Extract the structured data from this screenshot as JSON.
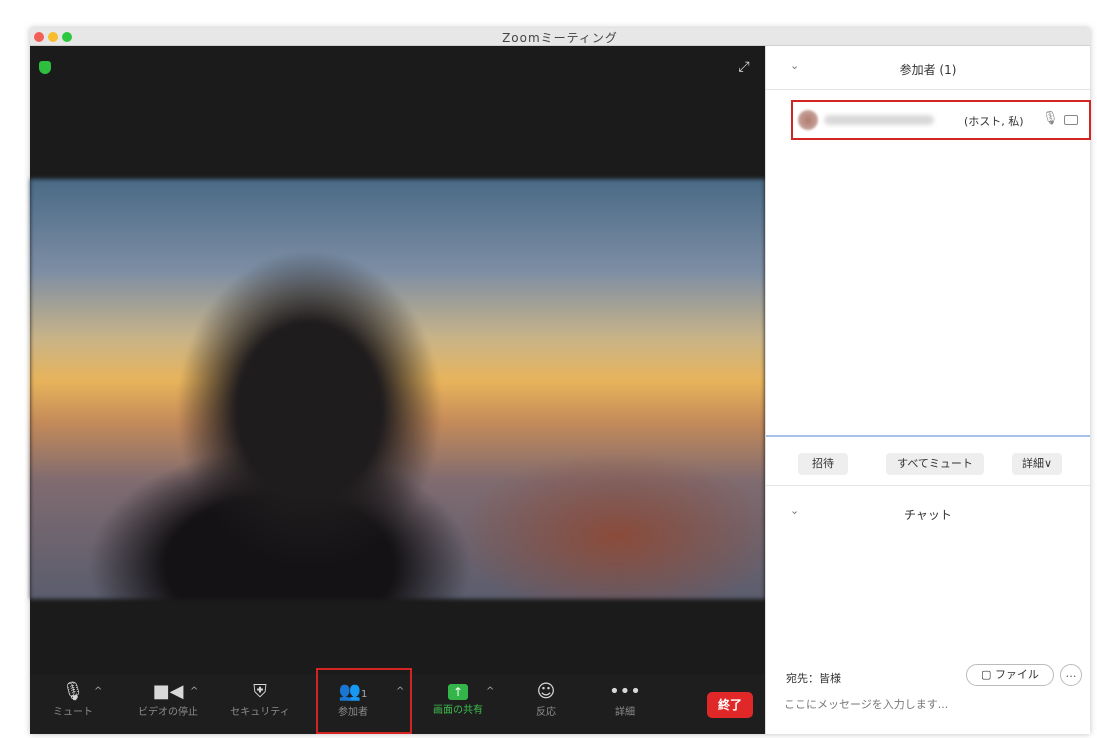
{
  "window": {
    "title": "Zoomミーティング"
  },
  "toolbar": {
    "mute_label": "ミュート",
    "video_label": "ビデオの停止",
    "security_label": "セキュリティ",
    "participants_label": "参加者",
    "participants_count": "1",
    "share_label": "画面の共有",
    "reactions_label": "反応",
    "more_label": "詳細",
    "end_label": "終了"
  },
  "panel": {
    "participants_title": "参加者 (1)",
    "participant": {
      "role": "(ホスト, 私)"
    },
    "invite_label": "招待",
    "mute_all_label": "すべてミュート",
    "more_label": "詳細∨",
    "chat_title": "チャット",
    "to_label": "宛先：皆様",
    "file_label": "ファイル",
    "more_icon": "…",
    "message_placeholder": "ここにメッセージを入力します..."
  },
  "colors": {
    "share_green": "#33b54a",
    "end_red": "#e02828",
    "highlight_red": "#d32424",
    "toolbar_bg": "#1e1e1e"
  },
  "icons": [
    "shield-icon",
    "expand-icon",
    "microphone-icon",
    "camera-icon",
    "security-shield-icon",
    "participants-icon",
    "share-screen-icon",
    "reaction-icon",
    "more-dots-icon",
    "microphone-small-icon",
    "camera-small-icon",
    "file-icon"
  ]
}
